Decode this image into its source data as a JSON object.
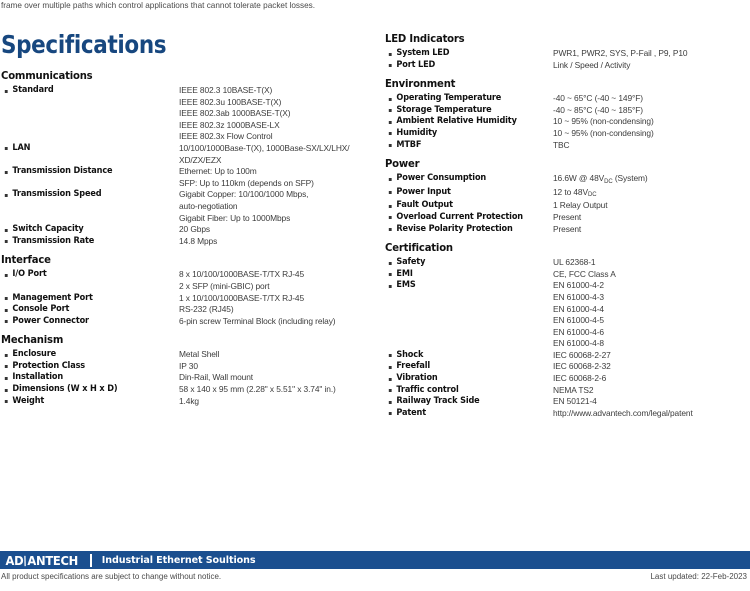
{
  "intro_text": "frame over multiple paths which control applications that cannot tolerate packet losses.",
  "page_title": "Specifications",
  "colors": {
    "title_blue": "#17477f",
    "footer_blue": "#1b4f8f",
    "body_text": "#3c3c3c"
  },
  "left_column": [
    {
      "heading": "Communications",
      "rows": [
        {
          "label": "Standard",
          "values": [
            "IEEE 802.3 10BASE-T(X)",
            "IEEE 802.3u 100BASE-T(X)",
            "IEEE 802.3ab 1000BASE-T(X)",
            "IEEE 802.3z 1000BASE-LX",
            "IEEE 802.3x Flow Control"
          ]
        },
        {
          "label": "LAN",
          "values": [
            "10/100/1000Base-T(X), 1000Base-SX/LX/LHX/",
            "XD/ZX/EZX"
          ]
        },
        {
          "label": "Transmission Distance",
          "values": [
            "Ethernet: Up to 100m",
            "SFP: Up to 110km (depends on SFP)"
          ]
        },
        {
          "label": "Transmission Speed",
          "values": [
            "Gigabit Copper: 10/100/1000 Mbps,",
            "auto-negotiation",
            "Gigabit Fiber: Up to 1000Mbps"
          ]
        },
        {
          "label": "Switch Capacity",
          "values": [
            "20 Gbps"
          ]
        },
        {
          "label": "Transmission Rate",
          "values": [
            "14.8 Mpps"
          ]
        }
      ]
    },
    {
      "heading": "Interface",
      "rows": [
        {
          "label": "I/O Port",
          "values": [
            "8 x 10/100/1000BASE-T/TX RJ-45",
            "2 x SFP (mini-GBIC) port"
          ]
        },
        {
          "label": "Management Port",
          "values": [
            "1 x 10/100/1000BASE-T/TX RJ-45"
          ]
        },
        {
          "label": "Console Port",
          "values": [
            "RS-232 (RJ45)"
          ]
        },
        {
          "label": "Power Connector",
          "values": [
            "6-pin screw Terminal Block (including relay)"
          ]
        }
      ]
    },
    {
      "heading": "Mechanism",
      "rows": [
        {
          "label": "Enclosure",
          "values": [
            "Metal Shell"
          ]
        },
        {
          "label": "Protection Class",
          "values": [
            "IP 30"
          ]
        },
        {
          "label": "Installation",
          "values": [
            "Din-Rail, Wall mount"
          ]
        },
        {
          "label": "Dimensions (W x H x D)",
          "values": [
            "58 x 140 x 95 mm (2.28\" x 5.51\" x 3.74\" in.)"
          ]
        },
        {
          "label": "Weight",
          "values": [
            "1.4kg"
          ]
        }
      ]
    }
  ],
  "right_column": [
    {
      "heading": "LED Indicators",
      "rows": [
        {
          "label": "System LED",
          "values": [
            "PWR1, PWR2, SYS, P-Fail , P9, P10"
          ]
        },
        {
          "label": "Port LED",
          "values": [
            "Link / Speed / Activity"
          ]
        }
      ]
    },
    {
      "heading": "Environment",
      "rows": [
        {
          "label": "Operating Temperature",
          "values": [
            "-40 ~ 65°C (-40 ~ 149°F)"
          ]
        },
        {
          "label": "Storage Temperature",
          "values": [
            "-40 ~ 85°C (-40 ~ 185°F)"
          ]
        },
        {
          "label": "Ambient Relative Humidity",
          "values": [
            "10 ~ 95% (non-condensing)"
          ]
        },
        {
          "label": "Humidity",
          "values": [
            "10 ~ 95% (non-condensing)"
          ]
        },
        {
          "label": "MTBF",
          "values": [
            "TBC"
          ]
        }
      ]
    },
    {
      "heading": "Power",
      "rows": [
        {
          "label": "Power Consumption",
          "values": [
            "16.6W @ 48V|DC| (System)"
          ]
        },
        {
          "label": "Power Input",
          "values": [
            "12 to 48V|DC|"
          ]
        },
        {
          "label": "Fault Output",
          "values": [
            "1 Relay Output"
          ]
        },
        {
          "label": "Overload Current Protection",
          "values": [
            "Present"
          ]
        },
        {
          "label": "Revise Polarity Protection",
          "values": [
            "Present"
          ]
        }
      ]
    },
    {
      "heading": "Certification",
      "rows": [
        {
          "label": "Safety",
          "values": [
            "UL 62368-1"
          ]
        },
        {
          "label": "EMI",
          "values": [
            "CE, FCC Class A"
          ]
        },
        {
          "label": "EMS",
          "values": [
            "EN 61000-4-2",
            "EN 61000-4-3",
            "EN 61000-4-4",
            "EN 61000-4-5",
            "EN 61000-4-6",
            "EN 61000-4-8"
          ]
        },
        {
          "label": "Shock",
          "values": [
            "IEC 60068-2-27"
          ]
        },
        {
          "label": "Freefall",
          "values": [
            "IEC 60068-2-32"
          ]
        },
        {
          "label": "Vibration",
          "values": [
            "IEC 60068-2-6"
          ]
        },
        {
          "label": "Traffic control",
          "values": [
            "NEMA TS2"
          ]
        },
        {
          "label": "Railway Track Side",
          "values": [
            "EN 50121-4"
          ]
        },
        {
          "label": "Patent",
          "values": [
            "http://www.advantech.com/legal/patent"
          ]
        }
      ]
    }
  ],
  "footer": {
    "logo_part1": "AD",
    "logo_slash": "\\",
    "logo_part2": "ANTECH",
    "tagline": "Industrial Ethernet Soultions",
    "note": "All product specifications are subject to change without notice.",
    "last_updated": "Last updated: 22-Feb-2023"
  }
}
